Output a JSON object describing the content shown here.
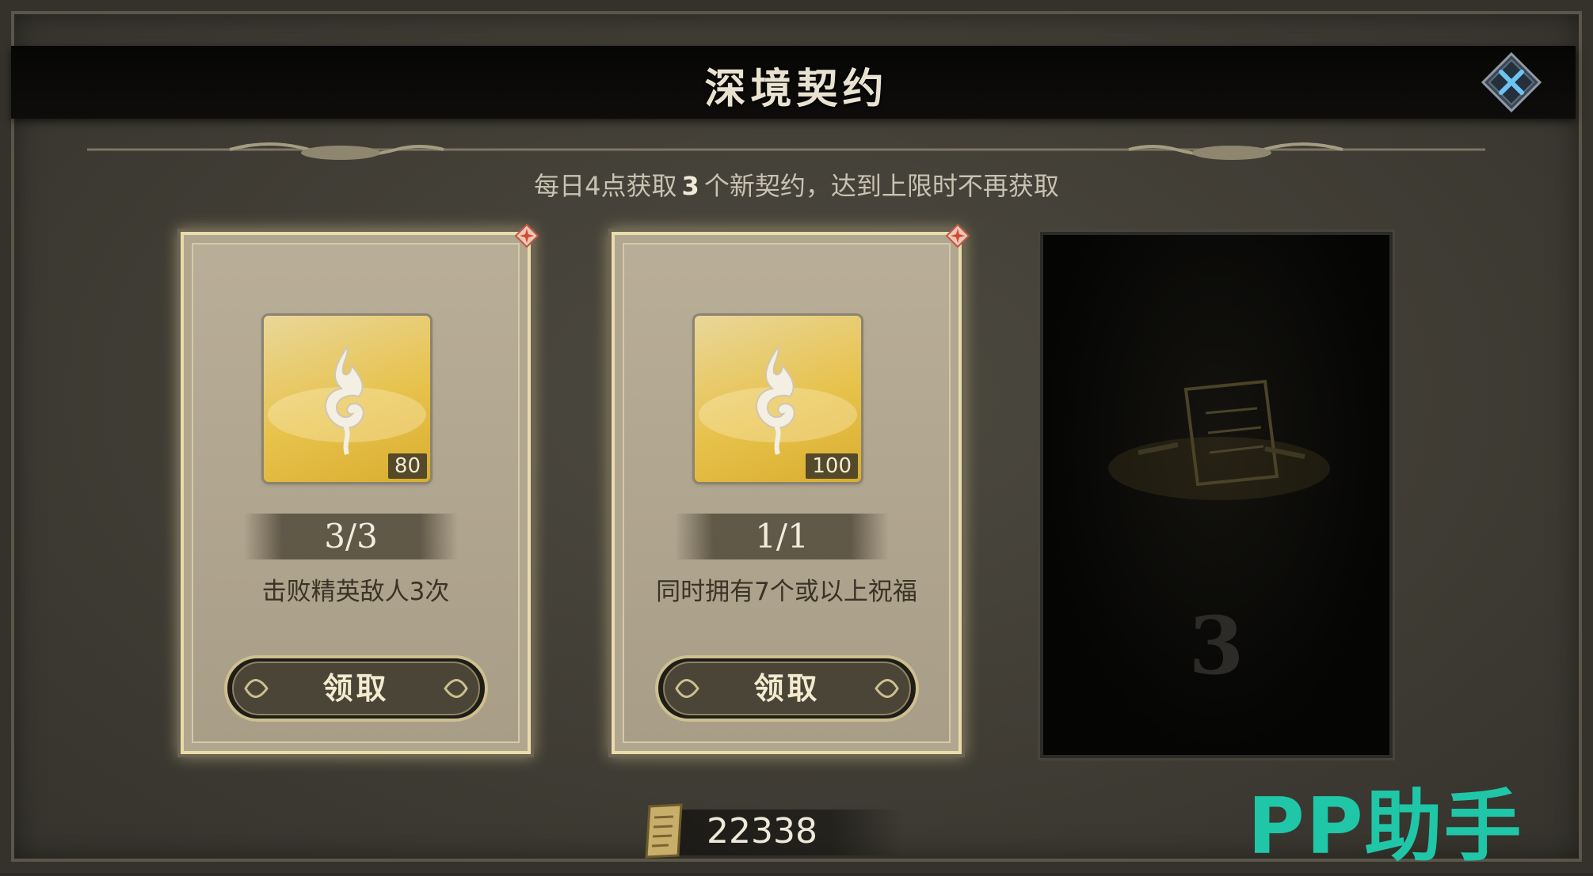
{
  "header": {
    "title": "深境契约"
  },
  "subtitle": {
    "prefix": "每日4点获取",
    "count": "3",
    "suffix": "个新契约，达到上限时不再获取"
  },
  "contracts": [
    {
      "reward_count": "80",
      "progress": "3/3",
      "description": "击败精英敌人3次",
      "claim_label": "领取"
    },
    {
      "reward_count": "100",
      "progress": "1/1",
      "description": "同时拥有7个或以上祝福",
      "claim_label": "领取"
    }
  ],
  "locked_slot": {
    "number": "3"
  },
  "currency": {
    "value": "22338"
  },
  "watermark": {
    "text": "PP助手"
  },
  "colors": {
    "accent_gold": "#e8c24c",
    "text_light": "#efe9d8",
    "watermark_teal": "#1fc7a8"
  }
}
